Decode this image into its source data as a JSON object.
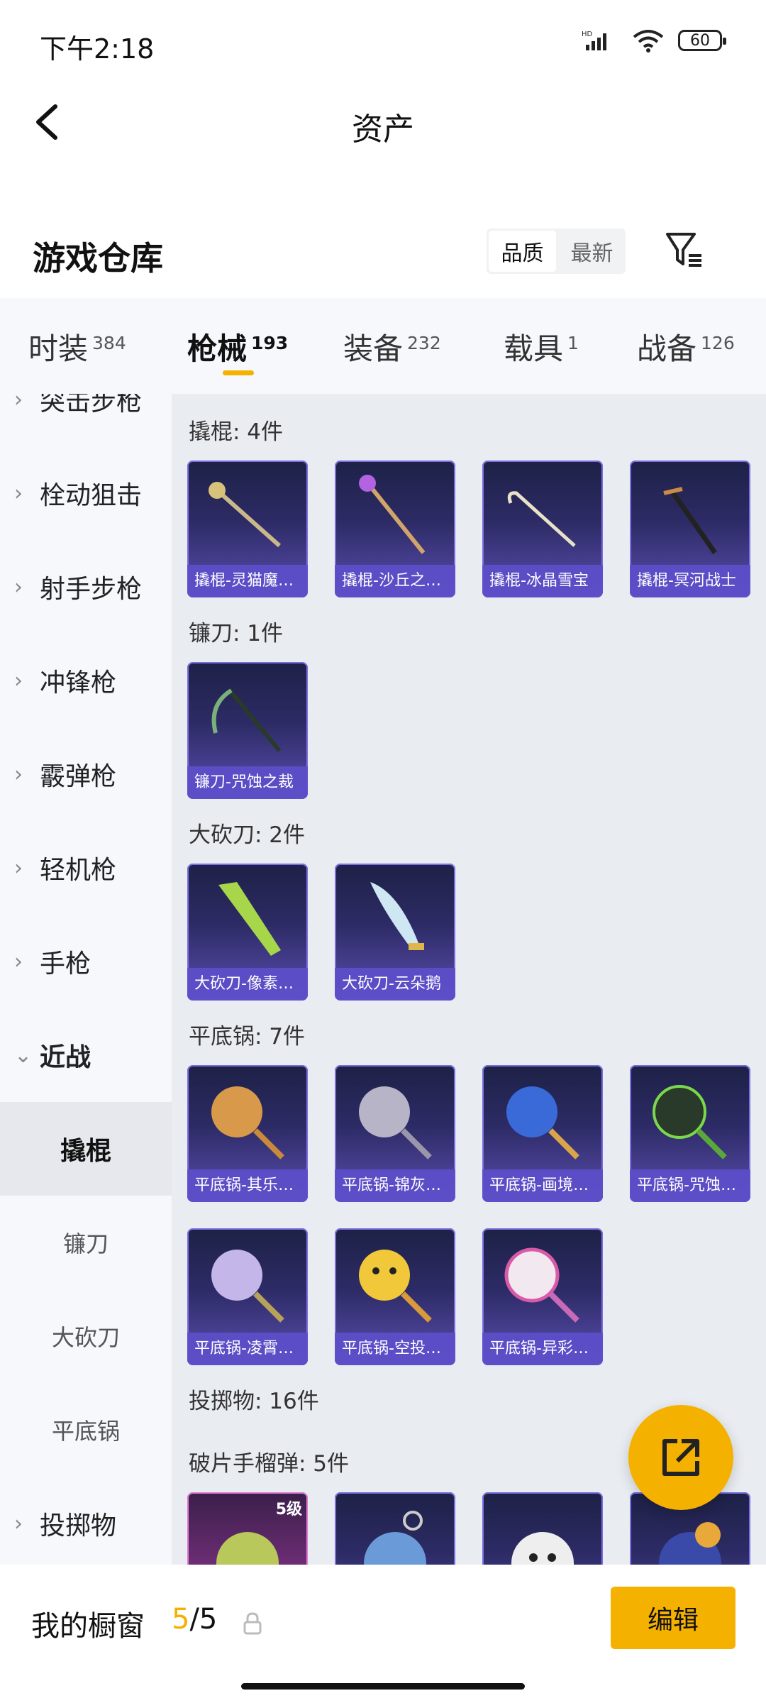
{
  "status_bar": {
    "time": "下午2:18",
    "network": "HD",
    "battery": "60"
  },
  "nav": {
    "title": "资产"
  },
  "header": {
    "title": "游戏仓库",
    "sort_options": [
      "品质",
      "最新"
    ],
    "active_sort": "品质"
  },
  "tabs": [
    {
      "label": "时装",
      "count": "384"
    },
    {
      "label": "枪械",
      "count": "193",
      "active": true
    },
    {
      "label": "装备",
      "count": "232"
    },
    {
      "label": "载具",
      "count": "1"
    },
    {
      "label": "战备",
      "count": "126"
    }
  ],
  "sidebar": {
    "cut_item": "突击步枪",
    "items": [
      "栓动狙击",
      "射手步枪",
      "冲锋枪",
      "霰弹枪",
      "轻机枪",
      "手枪"
    ],
    "open_item": "近战",
    "sub_items": [
      "撬棍",
      "镰刀",
      "大砍刀",
      "平底锅"
    ],
    "active_sub": "撬棍",
    "last_item": "投掷物"
  },
  "sections": [
    {
      "title": "撬棍: 4件",
      "items": [
        "撬棍-灵猫魔…",
        "撬棍-沙丘之…",
        "撬棍-冰晶雪宝",
        "撬棍-冥河战士"
      ]
    },
    {
      "title": "镰刀: 1件",
      "items": [
        "镰刀-咒蚀之裁"
      ]
    },
    {
      "title": "大砍刀: 2件",
      "items": [
        "大砍刀-像素…",
        "大砍刀-云朵鹅"
      ]
    },
    {
      "title": "平底锅: 7件",
      "items": [
        "平底锅-其乐…",
        "平底锅-锦灰…",
        "平底锅-画境…",
        "平底锅-咒蚀…",
        "平底锅-凌霄…",
        "平底锅-空投…",
        "平底锅-异彩…"
      ]
    },
    {
      "title": "投掷物: 16件"
    },
    {
      "title": "破片手榴弹: 5件",
      "level_badge": "5级"
    }
  ],
  "bottom_bar": {
    "title": "我的橱窗",
    "current": "5",
    "total": "/5",
    "edit_label": "编辑"
  },
  "colors": {
    "accent": "#f5b100",
    "card_purple": "#5c4ec8",
    "page_bg": "#e9ecf1"
  }
}
